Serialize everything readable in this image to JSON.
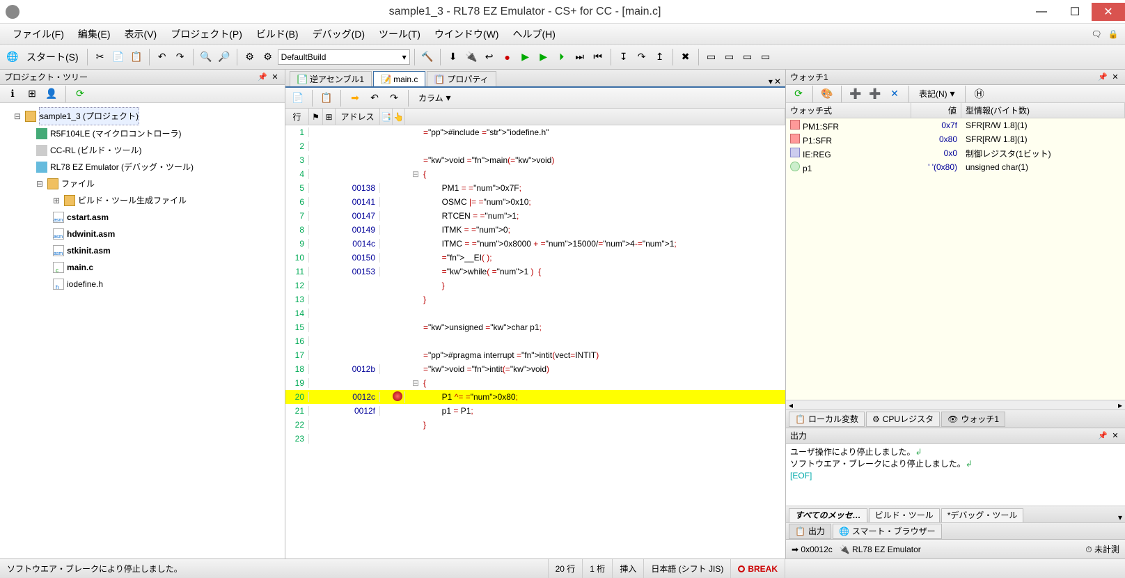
{
  "title": "sample1_3 - RL78 EZ Emulator - CS+ for CC - [main.c]",
  "menu": {
    "file": "ファイル(F)",
    "edit": "編集(E)",
    "view": "表示(V)",
    "project": "プロジェクト(P)",
    "build": "ビルド(B)",
    "debug": "デバッグ(D)",
    "tool": "ツール(T)",
    "window": "ウインドウ(W)",
    "help": "ヘルプ(H)"
  },
  "toolbar": {
    "start": "スタート(S)",
    "build_config": "DefaultBuild"
  },
  "project_tree": {
    "title": "プロジェクト・ツリー",
    "root": "sample1_3 (プロジェクト)",
    "mcu": "R5F104LE (マイクロコントローラ)",
    "cc": "CC-RL (ビルド・ツール)",
    "emu": "RL78 EZ Emulator (デバッグ・ツール)",
    "files": "ファイル",
    "buildgen": "ビルド・ツール生成ファイル",
    "cstart": "cstart.asm",
    "hdwinit": "hdwinit.asm",
    "stkinit": "stkinit.asm",
    "mainc": "main.c",
    "iodef": "iodefine.h"
  },
  "editor": {
    "tabs": {
      "disasm": "逆アセンブル1",
      "main": "main.c",
      "prop": "プロパティ"
    },
    "column_btn": "カラム",
    "header": {
      "line": "行",
      "addr": "アドレス"
    },
    "lines": [
      {
        "n": 1,
        "addr": "",
        "code": "#include \"iodefine.h\"",
        "fold": ""
      },
      {
        "n": 2,
        "addr": "",
        "code": "",
        "fold": ""
      },
      {
        "n": 3,
        "addr": "",
        "code": "void main(void)",
        "fold": ""
      },
      {
        "n": 4,
        "addr": "",
        "code": "{",
        "fold": "⊟"
      },
      {
        "n": 5,
        "addr": "00138",
        "code": "        PM1 = 0x7F;",
        "fold": "",
        "bar": true
      },
      {
        "n": 6,
        "addr": "00141",
        "code": "        OSMC |= 0x10;",
        "fold": "",
        "bar": true
      },
      {
        "n": 7,
        "addr": "00147",
        "code": "        RTCEN = 1;",
        "fold": "",
        "bar": true
      },
      {
        "n": 8,
        "addr": "00149",
        "code": "        ITMK = 0;",
        "fold": "",
        "bar": true
      },
      {
        "n": 9,
        "addr": "0014c",
        "code": "        ITMC = 0x8000 + 15000/4-1;",
        "fold": "",
        "bar": true
      },
      {
        "n": 10,
        "addr": "00150",
        "code": "        __EI( );",
        "fold": "",
        "bar": true
      },
      {
        "n": 11,
        "addr": "00153",
        "code": "        while( 1 )  {",
        "fold": "",
        "bar": true
      },
      {
        "n": 12,
        "addr": "",
        "code": "        }",
        "fold": ""
      },
      {
        "n": 13,
        "addr": "",
        "code": "}",
        "fold": ""
      },
      {
        "n": 14,
        "addr": "",
        "code": "",
        "fold": ""
      },
      {
        "n": 15,
        "addr": "",
        "code": "unsigned char p1;",
        "fold": ""
      },
      {
        "n": 16,
        "addr": "",
        "code": "",
        "fold": ""
      },
      {
        "n": 17,
        "addr": "",
        "code": "#pragma interrupt intit(vect=INTIT)",
        "fold": ""
      },
      {
        "n": 18,
        "addr": "0012b",
        "code": "void intit(void)",
        "fold": "",
        "bar": true
      },
      {
        "n": 19,
        "addr": "",
        "code": "{",
        "fold": "⊟"
      },
      {
        "n": 20,
        "addr": "0012c",
        "code": "        P1 ^= 0x80;",
        "fold": "",
        "bar": true,
        "hl": true,
        "bp": true
      },
      {
        "n": 21,
        "addr": "0012f",
        "code": "        p1 = P1;",
        "fold": "",
        "bar": true
      },
      {
        "n": 22,
        "addr": "",
        "code": "}",
        "fold": ""
      },
      {
        "n": 23,
        "addr": "",
        "code": "",
        "fold": ""
      }
    ]
  },
  "watch": {
    "title": "ウォッチ1",
    "notation": "表記(N)",
    "cols": {
      "expr": "ウォッチ式",
      "val": "値",
      "type": "型情報(バイト数)"
    },
    "rows": [
      {
        "expr": "PM1:SFR",
        "val": "0x7f",
        "type": "SFR[R/W 1.8](1)"
      },
      {
        "expr": "P1:SFR",
        "val": "0x80",
        "type": "SFR[R/W 1.8](1)"
      },
      {
        "expr": "IE:REG",
        "val": "0x0",
        "type": "制御レジスタ(1ビット)",
        "icon": "reg"
      },
      {
        "expr": "p1",
        "val": "' '(0x80)",
        "type": "unsigned char(1)",
        "icon": "var"
      }
    ],
    "tabs": {
      "local": "ローカル変数",
      "cpu": "CPUレジスタ",
      "watch": "ウォッチ1"
    }
  },
  "output": {
    "title": "出力",
    "lines": [
      "ユーザ操作により停止しました。",
      "ソフトウエア・ブレークにより停止しました。"
    ],
    "eof": "[EOF]",
    "tabs": {
      "all": "すべてのメッセ…",
      "build": "ビルド・ツール",
      "debug": "*デバッグ・ツール"
    },
    "bottomtabs": {
      "output": "出力",
      "smart": "スマート・ブラウザー"
    }
  },
  "status": {
    "msg": "ソフトウエア・ブレークにより停止しました。",
    "line": "20 行",
    "col": "1 桁",
    "mode": "挿入",
    "enc": "日本語 (シフト JIS)",
    "break": "BREAK",
    "pc": "0x0012c",
    "emu": "RL78 EZ Emulator",
    "timer": "未計測"
  }
}
